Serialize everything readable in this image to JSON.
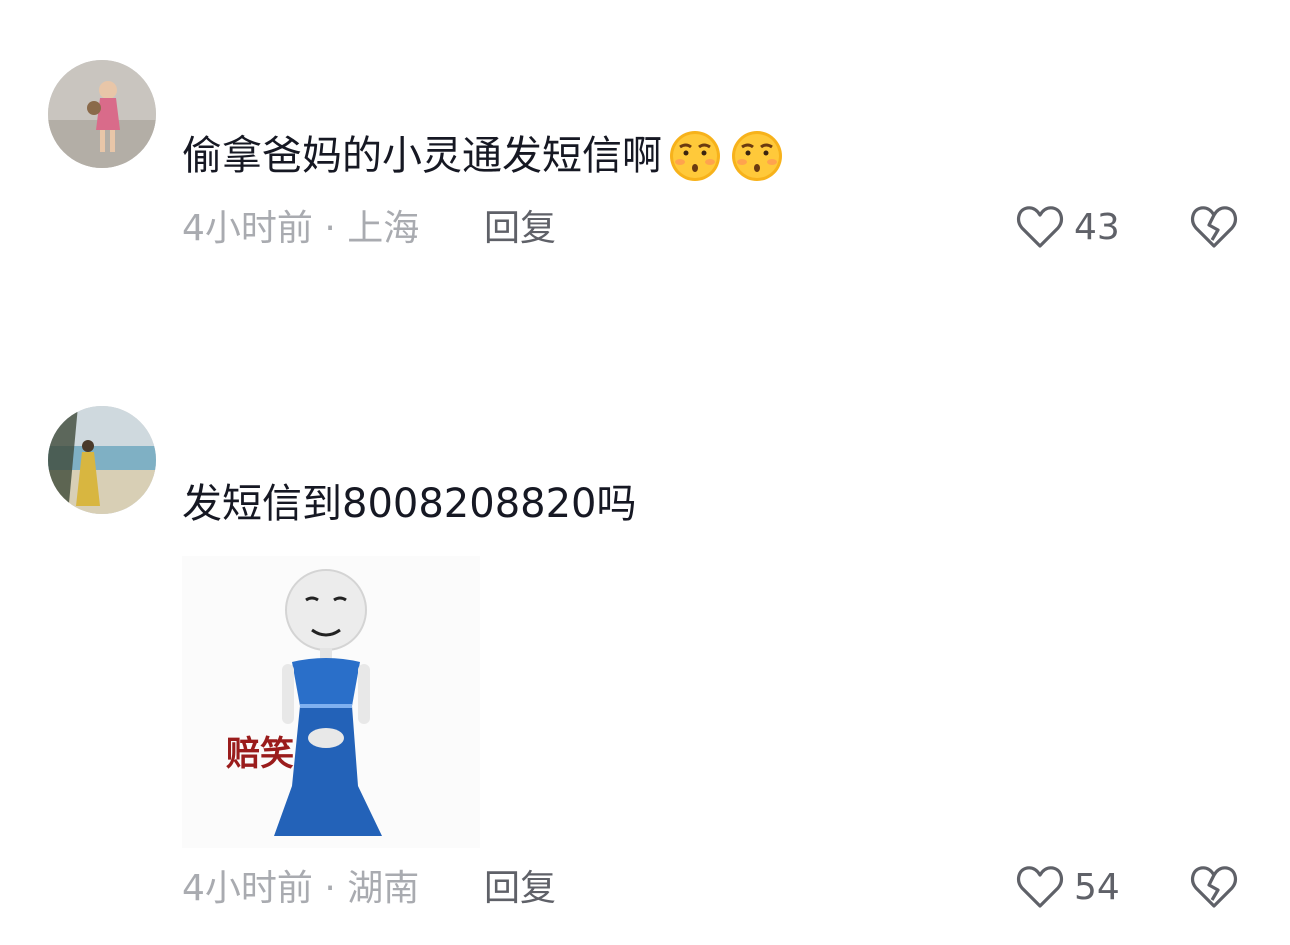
{
  "comments": [
    {
      "text": "偷拿爸妈的小灵通发短信啊",
      "emojis": [
        "smirk-face-emoji",
        "smirk-face-emoji"
      ],
      "time": "4小时前",
      "separator": "·",
      "location": "上海",
      "reply_label": "回复",
      "like_count": "43"
    },
    {
      "text": "发短信到8008208820吗",
      "sticker_label": "赔笑",
      "time": "4小时前",
      "separator": "·",
      "location": "湖南",
      "reply_label": "回复",
      "like_count": "54"
    }
  ],
  "colors": {
    "text": "#161823",
    "meta": "#a9abb0",
    "action": "#5f6168",
    "sticker_label": "#9a1c1c"
  },
  "icons": [
    "heart-outline-icon",
    "broken-heart-icon"
  ]
}
